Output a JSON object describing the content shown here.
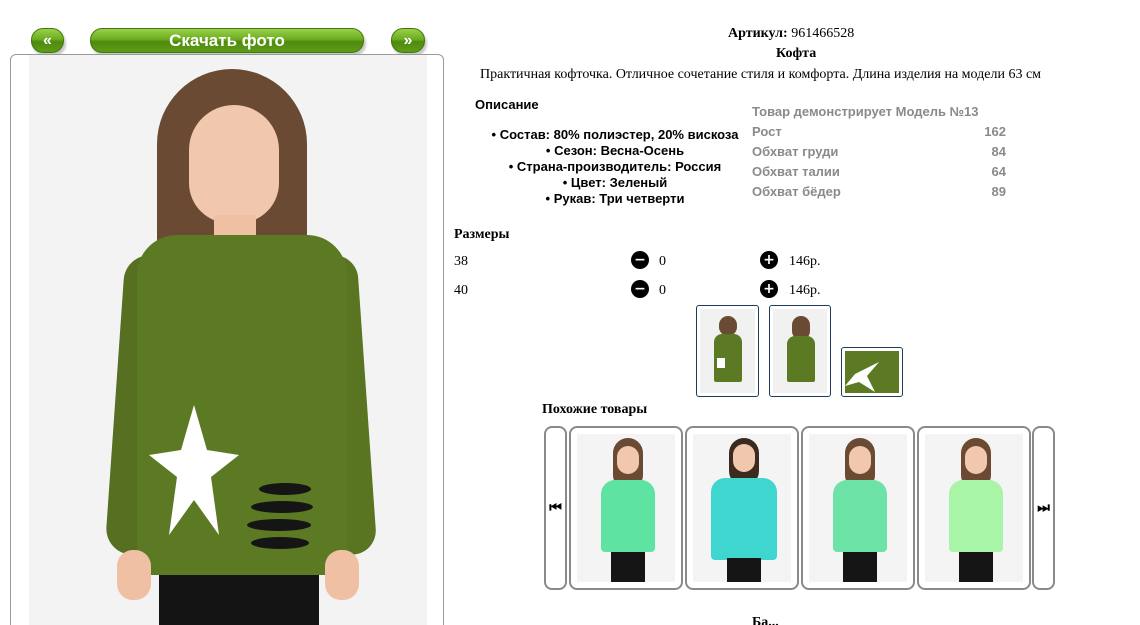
{
  "nav": {
    "prev_label": "«",
    "download_label": "Скачать фото",
    "next_label": "»"
  },
  "product": {
    "sku_label": "Артикул:",
    "sku_value": "961466528",
    "title": "Кофта",
    "description": "Практичная кофточка. Отличное сочетание стиля и комфорта. Длина изделия на модели 63 см"
  },
  "specs": {
    "heading": "Описание",
    "items": [
      "Состав: 80% полиэстер, 20% вискоза",
      "Сезон: Весна-Осень",
      "Страна-производитель: Россия",
      "Цвет: Зеленый",
      "Рукав: Три четверти"
    ]
  },
  "model": {
    "title": "Товар демонстрирует Модель №13",
    "rows": [
      {
        "label": "Рост",
        "value": "162"
      },
      {
        "label": "Обхват груди",
        "value": "84"
      },
      {
        "label": "Обхват талии",
        "value": "64"
      },
      {
        "label": "Обхват бёдер",
        "value": "89"
      }
    ]
  },
  "sizes": {
    "heading": "Размеры",
    "rows": [
      {
        "size": "38",
        "qty": "0",
        "price": "146р."
      },
      {
        "size": "40",
        "qty": "0",
        "price": "146р."
      }
    ],
    "minus_icon": "−",
    "plus_icon": "+"
  },
  "similar": {
    "heading": "Похожие товары",
    "prev_icon": "⏮",
    "next_icon": "⏭",
    "item_colors": [
      "#5fe3a3",
      "#3fd6d0",
      "#6ee3a8",
      "#a8f5a8"
    ]
  },
  "footer_partial": "Ба..."
}
